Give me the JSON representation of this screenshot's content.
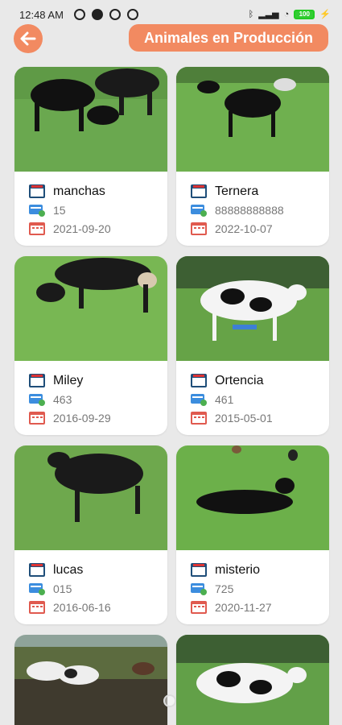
{
  "status": {
    "time": "12:48 AM",
    "battery": "100"
  },
  "header": {
    "back_icon": "arrow-left-icon",
    "title": "Animales en Producción"
  },
  "colors": {
    "accent": "#f28a61",
    "background": "#e9e9e9",
    "card": "#ffffff"
  },
  "animals": [
    {
      "name": "manchas",
      "code": "15",
      "date": "2021-09-20"
    },
    {
      "name": "Ternera",
      "code": "88888888888",
      "date": "2022-10-07"
    },
    {
      "name": "Miley",
      "code": "463",
      "date": "2016-09-29"
    },
    {
      "name": "Ortencia",
      "code": "461",
      "date": "2015-05-01"
    },
    {
      "name": "lucas",
      "code": "015",
      "date": "2016-06-16"
    },
    {
      "name": "misterio",
      "code": "725",
      "date": "2020-11-27"
    }
  ]
}
